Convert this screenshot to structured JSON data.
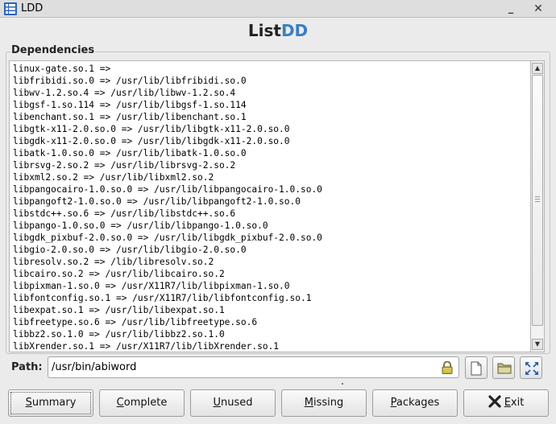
{
  "window": {
    "title": "LDD"
  },
  "brand": {
    "part1": "List",
    "part2": "DD"
  },
  "dependencies": {
    "label": "Dependencies",
    "items": [
      "linux-gate.so.1 =>",
      "libfribidi.so.0 => /usr/lib/libfribidi.so.0",
      "libwv-1.2.so.4 => /usr/lib/libwv-1.2.so.4",
      "libgsf-1.so.114 => /usr/lib/libgsf-1.so.114",
      "libenchant.so.1 => /usr/lib/libenchant.so.1",
      "libgtk-x11-2.0.so.0 => /usr/lib/libgtk-x11-2.0.so.0",
      "libgdk-x11-2.0.so.0 => /usr/lib/libgdk-x11-2.0.so.0",
      "libatk-1.0.so.0 => /usr/lib/libatk-1.0.so.0",
      "librsvg-2.so.2 => /usr/lib/librsvg-2.so.2",
      "libxml2.so.2 => /usr/lib/libxml2.so.2",
      "libpangocairo-1.0.so.0 => /usr/lib/libpangocairo-1.0.so.0",
      "libpangoft2-1.0.so.0 => /usr/lib/libpangoft2-1.0.so.0",
      "libstdc++.so.6 => /usr/lib/libstdc++.so.6",
      "libpango-1.0.so.0 => /usr/lib/libpango-1.0.so.0",
      "libgdk_pixbuf-2.0.so.0 => /usr/lib/libgdk_pixbuf-2.0.so.0",
      "libgio-2.0.so.0 => /usr/lib/libgio-2.0.so.0",
      "libresolv.so.2 => /lib/libresolv.so.2",
      "libcairo.so.2 => /usr/lib/libcairo.so.2",
      "libpixman-1.so.0 => /usr/X11R7/lib/libpixman-1.so.0",
      "libfontconfig.so.1 => /usr/X11R7/lib/libfontconfig.so.1",
      "libexpat.so.1 => /usr/lib/libexpat.so.1",
      "libfreetype.so.6 => /usr/lib/libfreetype.so.6",
      "libbz2.so.1.0 => /usr/lib/libbz2.so.1.0",
      "libXrender.so.1 => /usr/X11R7/lib/libXrender.so.1"
    ]
  },
  "path": {
    "label": "Path:",
    "value": "/usr/bin/abiword"
  },
  "buttons": [
    {
      "pre": "",
      "u": "S",
      "post": "ummary"
    },
    {
      "pre": "",
      "u": "C",
      "post": "omplete"
    },
    {
      "pre": "",
      "u": "U",
      "post": "nused"
    },
    {
      "pre": "",
      "u": "M",
      "post": "issing"
    },
    {
      "pre": "",
      "u": "P",
      "post": "ackages"
    },
    {
      "pre": "",
      "u": "E",
      "post": "xit"
    }
  ],
  "icons": {
    "app": "list-grid-icon",
    "minimize": "minimize-icon",
    "close": "close-icon",
    "lock": "lock-icon",
    "new_file": "blank-document-icon",
    "open_folder": "folder-icon",
    "fullscreen": "expand-arrows-icon",
    "exit": "x-exit-icon"
  },
  "colors": {
    "brand_accent": "#3b7fc4",
    "window_bg": "#ebebeb"
  }
}
